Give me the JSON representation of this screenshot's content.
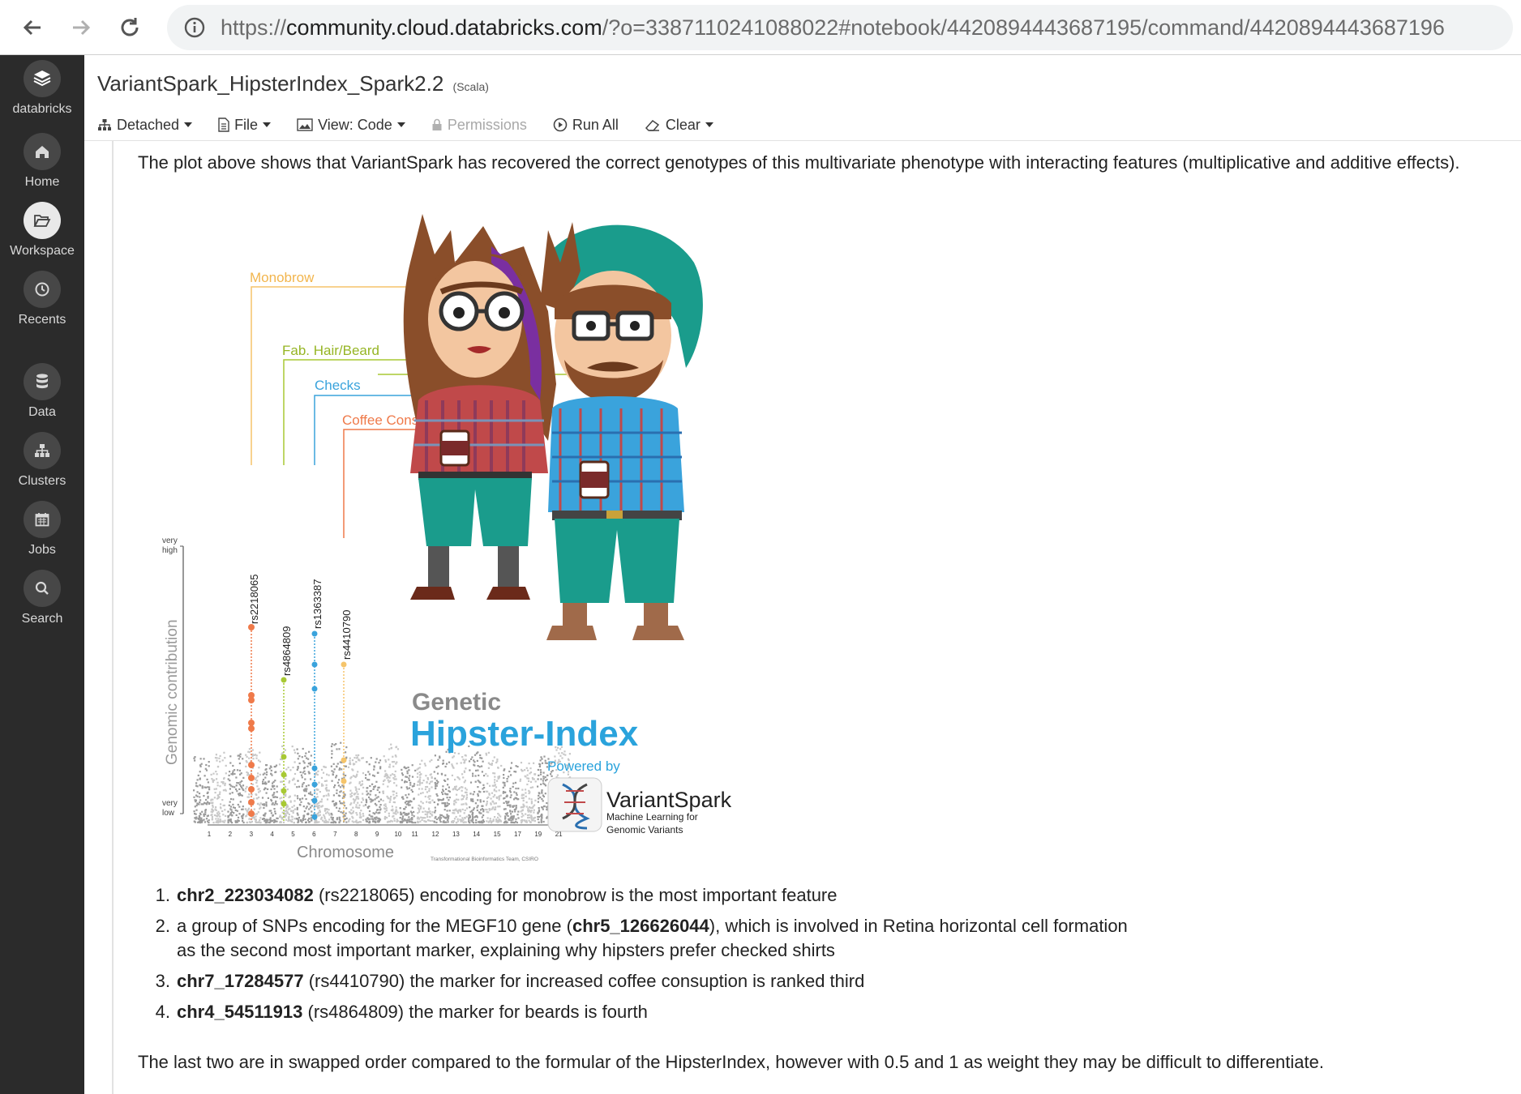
{
  "browser": {
    "url_prefix": "https://",
    "url_host": "community.cloud.databricks.com",
    "url_rest": "/?o=3387110241088022#notebook/4420894443687195/command/4420894443687196"
  },
  "sidebar": {
    "brand": "databricks",
    "items": [
      {
        "label": "Home",
        "icon": "home-icon"
      },
      {
        "label": "Workspace",
        "icon": "folder-open-icon"
      },
      {
        "label": "Recents",
        "icon": "clock-icon"
      },
      {
        "label": "Data",
        "icon": "database-icon"
      },
      {
        "label": "Clusters",
        "icon": "clusters-icon"
      },
      {
        "label": "Jobs",
        "icon": "calendar-icon"
      },
      {
        "label": "Search",
        "icon": "search-icon"
      }
    ],
    "active": "Workspace"
  },
  "notebook": {
    "title": "VariantSpark_HipsterIndex_Spark2.2",
    "language": "(Scala)",
    "toolbar": {
      "detached": "Detached",
      "file": "File",
      "view": "View: Code",
      "permissions": "Permissions",
      "run_all": "Run All",
      "clear": "Clear"
    }
  },
  "cell": {
    "intro": "The plot above shows that VariantSpark has recovered the correct genotypes of this multivariate phenotype with interacting features (multiplicative and additive effects).",
    "figure": {
      "labels": {
        "monobrow": "Monobrow",
        "hair": "Fab. Hair/Beard",
        "checks": "Checks",
        "coffee": "Coffee Consuption",
        "y_axis": "Genomic contribution",
        "y_high": "very high",
        "y_low": "very low",
        "x_axis": "Chromosome",
        "genetic": "Genetic",
        "hipster_index": "Hipster-Index",
        "powered_by": "Powered by",
        "variantspark": "VariantSpark",
        "vs_tag1": "Machine Learning for",
        "vs_tag2": "Genomic Variants",
        "credit": "Transformational Bioinformatics Team, CSIRO"
      },
      "snps": [
        "rs2218065",
        "rs4864809",
        "rs1363387",
        "rs4410790"
      ],
      "chromosomes": [
        "1",
        "2",
        "3",
        "4",
        "5",
        "6",
        "7",
        "8",
        "9",
        "10",
        "11",
        "12",
        "13",
        "14",
        "15",
        "17",
        "19",
        "21"
      ],
      "colors": {
        "monobrow": "#f5c46a",
        "hair": "#a8c934",
        "checks": "#3aa3dc",
        "coffee": "#ef7a4a",
        "hipster_blue": "#2aa3dc",
        "teal": "#1a9c8c"
      }
    },
    "list": [
      {
        "num": "1.",
        "bold": "chr2_223034082",
        "text": " (rs2218065) encoding for monobrow is the most important feature"
      },
      {
        "num": "2.",
        "pre": "a group of SNPs encoding for the MEGF10 gene (",
        "bold": "chr5_126626044",
        "text": "), which is involved in Retina horizontal cell formation",
        "line2": "as the second most important marker, explaining why hipsters prefer checked shirts"
      },
      {
        "num": "3.",
        "bold": "chr7_17284577",
        "text": " (rs4410790) the marker for increased coffee consuption is ranked third"
      },
      {
        "num": "4.",
        "bold": "chr4_54511913",
        "text": " (rs4864809) the marker for beards is fourth"
      }
    ],
    "outro": "The last two are in swapped order compared to the formular of the HipsterIndex, however with 0.5 and 1 as weight they may be difficult to differentiate."
  }
}
